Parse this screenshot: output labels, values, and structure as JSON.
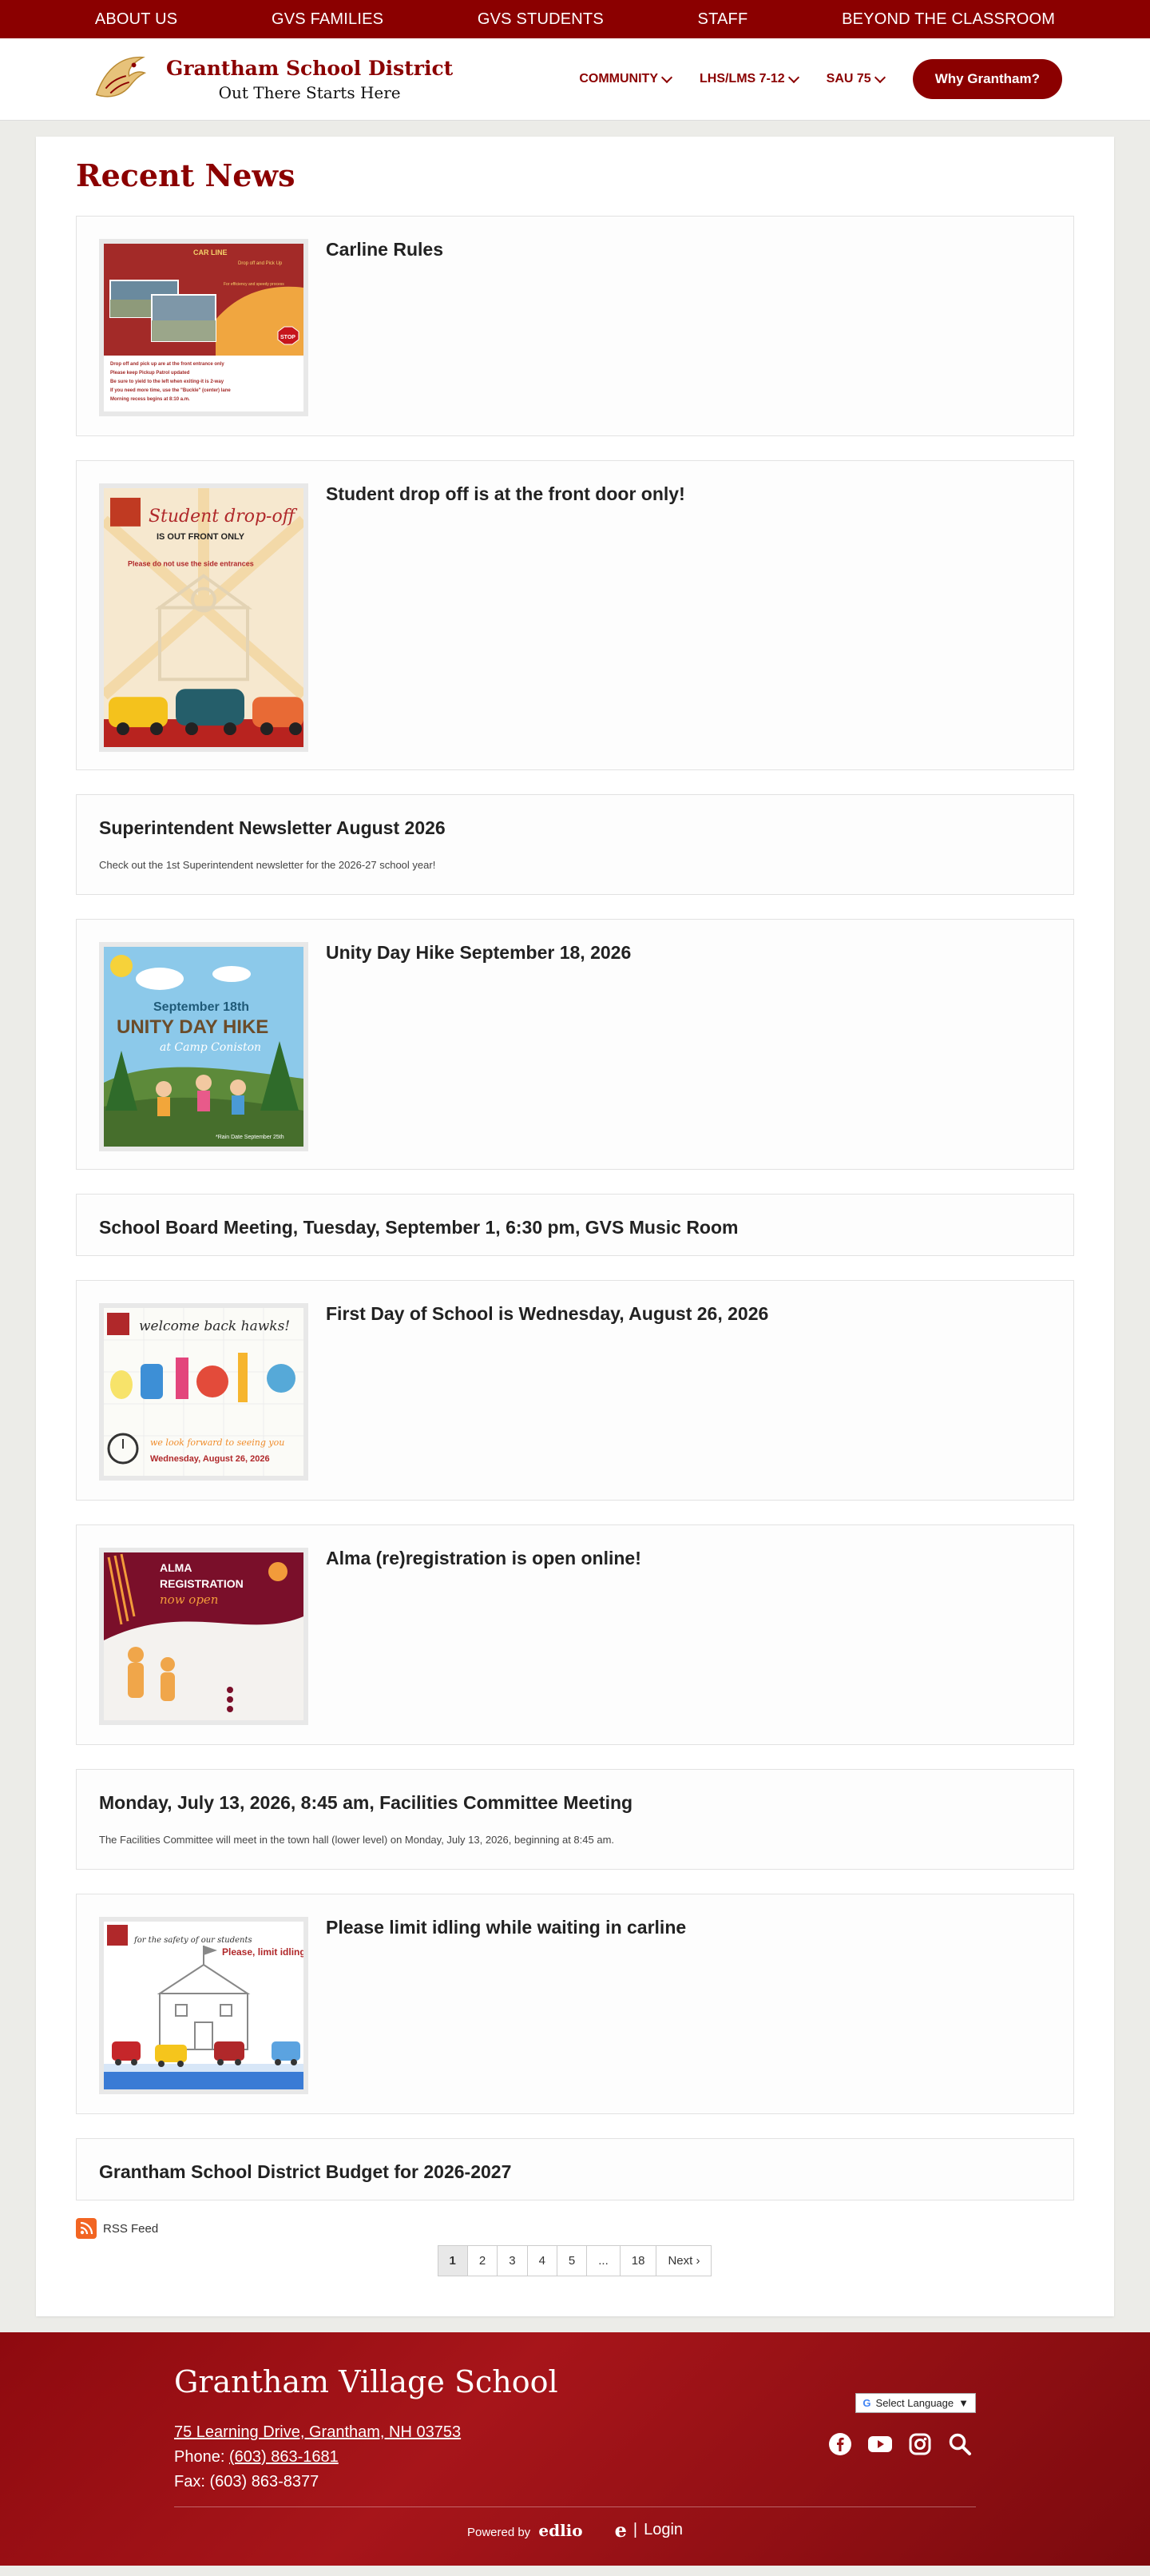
{
  "topnav": [
    "ABOUT US",
    "GVS FAMILIES",
    "GVS STUDENTS",
    "STAFF",
    "BEYOND THE CLASSROOM"
  ],
  "header": {
    "district": "Grantham School District",
    "tagline": "Out There Starts Here",
    "nav": [
      "COMMUNITY",
      "LHS/LMS 7-12",
      "SAU 75"
    ],
    "cta": "Why Grantham?"
  },
  "page_title": "Recent News",
  "news": [
    {
      "title": "Carline Rules",
      "thumb": "carline-rules-flyer"
    },
    {
      "title": "Student drop off is at the front door only!",
      "thumb": "drop-off-flyer"
    },
    {
      "title": "Superintendent Newsletter August 2026",
      "summary": "Check out the 1st Superintendent newsletter for the 2026-27 school year!"
    },
    {
      "title": "Unity Day Hike September 18, 2026",
      "thumb": "unity-day-hike-flyer"
    },
    {
      "title": "School Board Meeting, Tuesday, September 1, 6:30 pm, GVS Music Room"
    },
    {
      "title": "First Day of School is Wednesday, August 26, 2026",
      "thumb": "welcome-back-flyer"
    },
    {
      "title": "Alma (re)registration is open online!",
      "thumb": "alma-registration-flyer"
    },
    {
      "title": "Monday, July 13, 2026, 8:45 am, Facilities Committee Meeting",
      "summary": "The Facilities Committee will meet in the town hall (lower level) on Monday, July 13, 2026, beginning at 8:45 am."
    },
    {
      "title": "Please limit idling while waiting in carline",
      "thumb": "limit-idling-flyer"
    },
    {
      "title": "Grantham School District Budget for 2026-2027"
    }
  ],
  "thumb_text": {
    "carline": {
      "heading": "CAR LINE",
      "side": "Drop off and Pick Up",
      "side2": "For efficiency and speedy process",
      "stop": "STOP",
      "rules": [
        "Drop off and pick up are at the front entrance only",
        "Please keep Pickup Patrol updated",
        "Be sure to yield to the left when exiting-it is 2-way",
        "If you need more time, use the \"Buckle\" (center) lane",
        "Morning recess begins at 8:10 a.m."
      ]
    },
    "dropoff": {
      "line1": "Student drop-off",
      "line2": "IS OUT FRONT ONLY",
      "line3": "Please do not use the side entrances"
    },
    "hike": {
      "line1": "September 18th",
      "line2": "UNITY DAY HIKE",
      "line3": "at Camp Coniston",
      "note": "*Rain Date September 25th"
    },
    "welcome": {
      "line1": "welcome back hawks!",
      "line2": "we look forward to seeing you",
      "line3": "Wednesday, August 26, 2026"
    },
    "alma": {
      "line1": "ALMA",
      "line2": "REGISTRATION",
      "line3": "now open"
    },
    "idling": {
      "line1": "for the safety of our students",
      "line2": "Please, limit idling"
    }
  },
  "rss": "RSS Feed",
  "pagination": [
    "1",
    "2",
    "3",
    "4",
    "5",
    "...",
    "18",
    "Next"
  ],
  "footer": {
    "school": "Grantham Village School",
    "address": "75 Learning Drive, Grantham, NH 03753",
    "phone_label": "Phone:",
    "phone": "(603) 863-1681",
    "fax": "Fax: (603) 863-8377",
    "language": "Select Language",
    "powered_by": "Powered by",
    "powered_brand": "edlio",
    "login": "Login"
  },
  "colors": {
    "brand": "#8b0000",
    "rss": "#f26522"
  }
}
